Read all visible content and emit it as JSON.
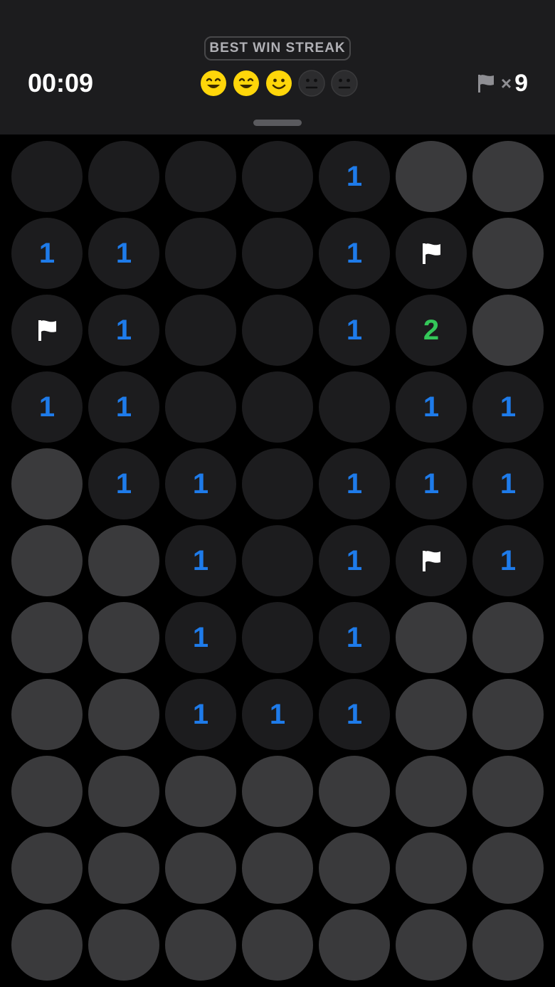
{
  "header": {
    "best_streak_label": "BEST WIN STREAK",
    "timer": "00:09",
    "flags_times": "×",
    "flags_count": "9",
    "streak_faces": [
      {
        "kind": "grin",
        "active": true
      },
      {
        "kind": "grin",
        "active": true
      },
      {
        "kind": "smile",
        "active": true
      },
      {
        "kind": "neutral",
        "active": false
      },
      {
        "kind": "neutral",
        "active": false
      }
    ]
  },
  "colors": {
    "one": "#1e7bea",
    "two": "#34c759",
    "face_active": "#ffd60a",
    "face_inactive": "#2c2c2e",
    "hidden": "#3a3a3c",
    "revealed": "#1c1c1e",
    "flag": "#ffffff"
  },
  "icons": {
    "flag": "flag-icon",
    "face": "face-icon"
  },
  "board": {
    "columns": 7,
    "rows": [
      [
        "R",
        "R",
        "R",
        "R",
        "1",
        "H",
        "H"
      ],
      [
        "1",
        "1",
        "R",
        "R",
        "1",
        "F",
        "H"
      ],
      [
        "F",
        "1",
        "R",
        "R",
        "1",
        "2",
        "H"
      ],
      [
        "1",
        "1",
        "R",
        "R",
        "R",
        "1",
        "1"
      ],
      [
        "H",
        "1",
        "1",
        "R",
        "1",
        "1",
        "1"
      ],
      [
        "H",
        "H",
        "1",
        "R",
        "1",
        "F",
        "1"
      ],
      [
        "H",
        "H",
        "1",
        "R",
        "1",
        "H",
        "H"
      ],
      [
        "H",
        "H",
        "1",
        "1",
        "1",
        "H",
        "H"
      ],
      [
        "H",
        "H",
        "H",
        "H",
        "H",
        "H",
        "H"
      ],
      [
        "H",
        "H",
        "H",
        "H",
        "H",
        "H",
        "H"
      ],
      [
        "H",
        "H",
        "H",
        "H",
        "H",
        "H",
        "H"
      ]
    ]
  }
}
